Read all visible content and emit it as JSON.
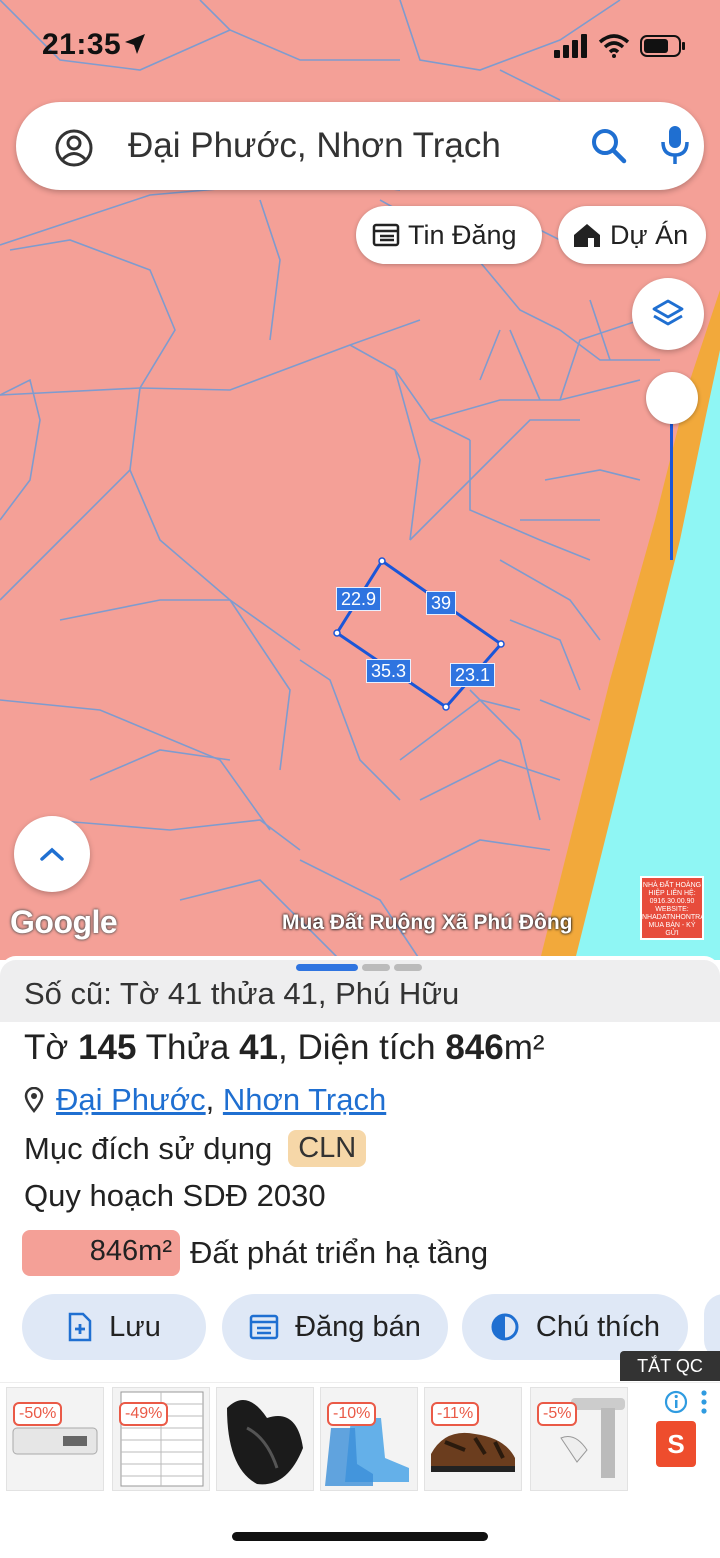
{
  "status": {
    "time": "21:35"
  },
  "search": {
    "query": "Đại Phước, Nhơn Trạch"
  },
  "chips": {
    "tin_dang": "Tin Đăng",
    "du_an": "Dự Án"
  },
  "map": {
    "edge_lengths": [
      "22.9",
      "39",
      "35.3",
      "23.1"
    ],
    "google": "Google",
    "overlay_text": "Mua Đất Ruộng Xã Phú Đông",
    "thumb_text": "NHÀ ĐẤT HOÀNG HIỆP LIÊN HỆ: 0916.30.00.90 WEBSITE: NHADATNHONTRACH.COM.VN MUA BÁN - KÝ GỬI",
    "colors": {
      "parcel": "#f4a097",
      "road": "#f2a93b",
      "river": "#8ff6f4",
      "outline": "#1a56d8"
    }
  },
  "sheet": {
    "old_info": "Số cũ: Tờ 41 thửa 41, Phú Hữu",
    "title": {
      "to_label": "Tờ",
      "to": "145",
      "thua_label": "Thửa",
      "thua": "41",
      "area_label": ", Diện tích",
      "area": "846",
      "unit": "m²"
    },
    "address": {
      "ward": "Đại Phước",
      "sep": ",",
      "district": "Nhơn Trạch"
    },
    "purpose_label": "Mục đích sử dụng",
    "purpose_code": "CLN",
    "plan_label": "Quy hoạch SDĐ 2030",
    "plan_area": "846m²",
    "plan_type": "Đất phát triển hạ tầng"
  },
  "actions": {
    "save": "Lưu",
    "post": "Đăng bán",
    "legend": "Chú thích"
  },
  "ads": {
    "close_label": "TẮT QC",
    "discounts": [
      "-50%",
      "-49%",
      "-10%",
      "-11%",
      "-5%"
    ]
  }
}
